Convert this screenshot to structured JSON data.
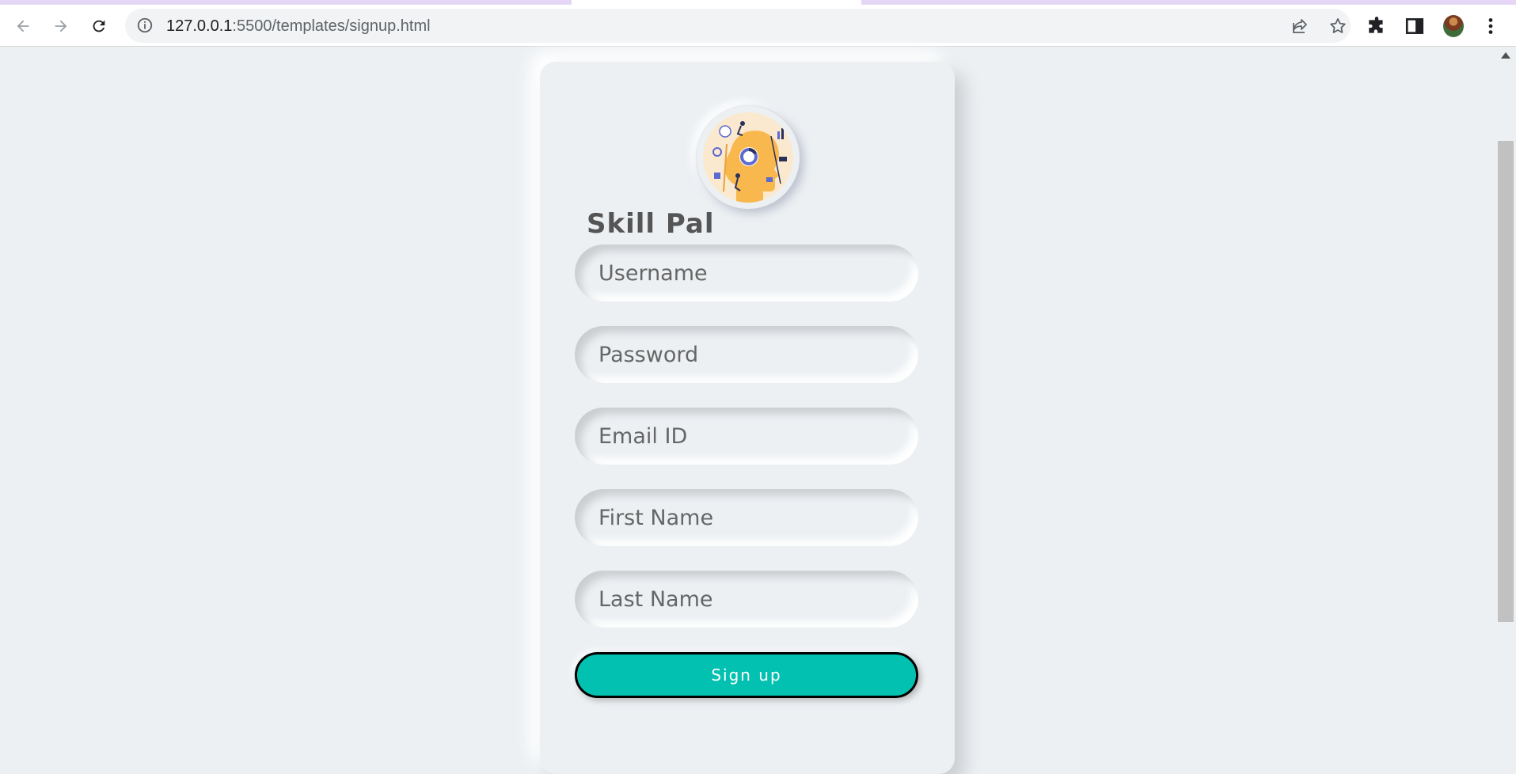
{
  "browser": {
    "url_host": "127.0.0.1",
    "url_rest": ":5500/templates/signup.html",
    "icons": {
      "back": "arrow-left-icon",
      "forward": "arrow-right-icon",
      "reload": "reload-icon",
      "site_info": "info-icon",
      "share": "share-icon",
      "bookmark": "star-icon",
      "extensions": "puzzle-icon",
      "side_panel": "side-panel-icon",
      "profile": "avatar",
      "menu": "kebab-menu-icon"
    }
  },
  "app": {
    "brand": "Skill Pal",
    "logo": "brain-illustration-logo"
  },
  "form": {
    "fields": [
      {
        "name": "username",
        "placeholder": "Username"
      },
      {
        "name": "password",
        "placeholder": "Password"
      },
      {
        "name": "email",
        "placeholder": "Email ID"
      },
      {
        "name": "first_name",
        "placeholder": "First Name"
      },
      {
        "name": "last_name",
        "placeholder": "Last Name"
      }
    ],
    "submit_label": "Sign up"
  },
  "colors": {
    "page_background": "#ecf0f3",
    "button": "#03c1b0",
    "text": "#555555",
    "logo_accent": "#f8b84e"
  }
}
